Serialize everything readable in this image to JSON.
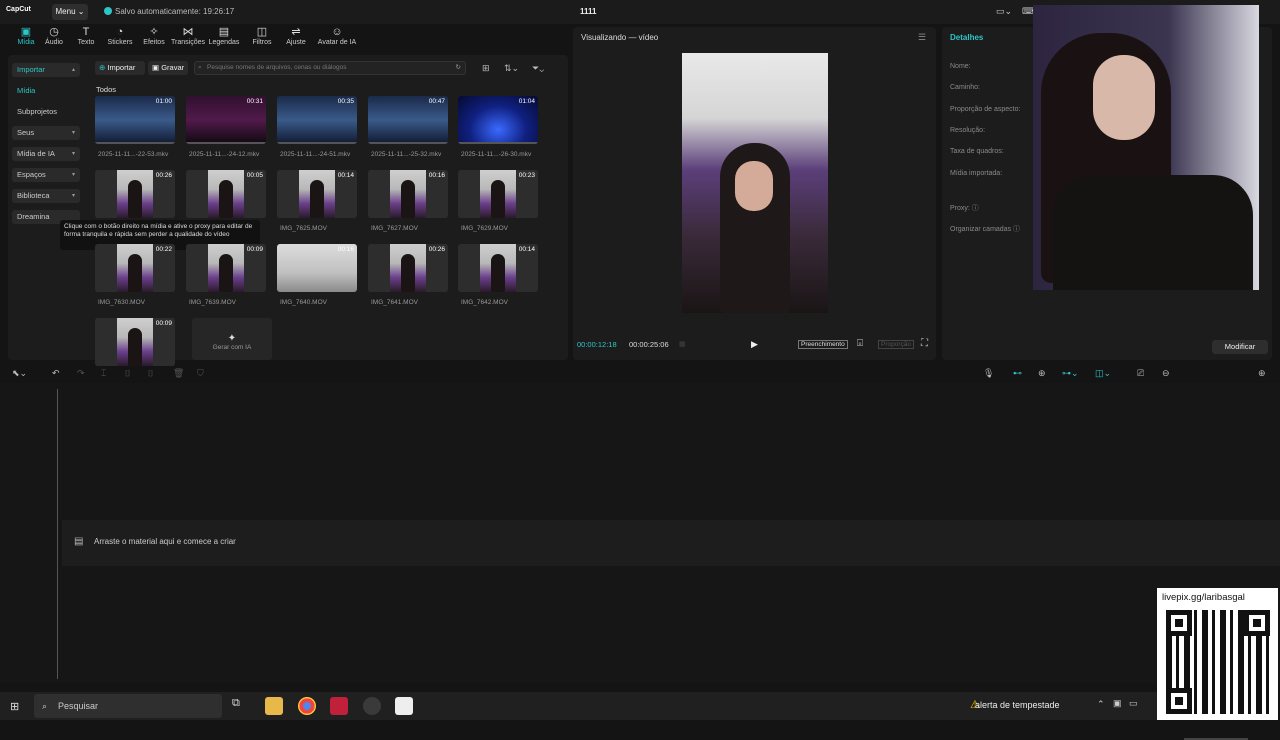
{
  "titlebar": {
    "logo": "CapCut",
    "menu_label": "Menu",
    "save_status": "Salvo automaticamente: 19:26:17",
    "project_title": "1111"
  },
  "toolbar": {
    "tools": [
      {
        "label": "Mídia",
        "icon": "media-icon"
      },
      {
        "label": "Áudio",
        "icon": "audio-icon"
      },
      {
        "label": "Texto",
        "icon": "text-icon"
      },
      {
        "label": "Stickers",
        "icon": "sticker-icon"
      },
      {
        "label": "Efeitos",
        "icon": "effects-icon"
      },
      {
        "label": "Transições",
        "icon": "transition-icon"
      },
      {
        "label": "Legendas",
        "icon": "captions-icon"
      },
      {
        "label": "Filtros",
        "icon": "filters-icon"
      },
      {
        "label": "Ajuste",
        "icon": "adjust-icon"
      },
      {
        "label": "Avatar de IA",
        "icon": "avatar-icon"
      }
    ]
  },
  "media": {
    "sidebar": {
      "import": "Importar",
      "media": "Mídia",
      "subprojects": "Subprojetos",
      "yours": "Seus",
      "ai_media": "Mídia de IA",
      "spaces": "Espaços",
      "library": "Biblioteca",
      "dreamina": "Dreamina"
    },
    "import_button": "Importar",
    "record_button": "Gravar",
    "search_placeholder": "Pesquise nomes de arquivos, cenas ou diálogos",
    "section_label": "Todos",
    "items": [
      {
        "name": "2025-11-11...-22-53.mkv",
        "duration": "01:00",
        "kind": "screen"
      },
      {
        "name": "2025-11-11...-24-12.mkv",
        "duration": "00:31",
        "kind": "dark"
      },
      {
        "name": "2025-11-11...-24-51.mkv",
        "duration": "00:35",
        "kind": "screen"
      },
      {
        "name": "2025-11-11...-25-32.mkv",
        "duration": "00:47",
        "kind": "screen"
      },
      {
        "name": "2025-11-11...-26-30.mkv",
        "duration": "01:04",
        "kind": "blue"
      },
      {
        "name": "",
        "duration": "00:26",
        "kind": "portrait"
      },
      {
        "name": "",
        "duration": "00:05",
        "kind": "portrait"
      },
      {
        "name": "IMG_7625.MOV",
        "duration": "00:14",
        "kind": "portrait"
      },
      {
        "name": "IMG_7627.MOV",
        "duration": "00:16",
        "kind": "portrait"
      },
      {
        "name": "IMG_7629.MOV",
        "duration": "00:23",
        "kind": "portrait"
      },
      {
        "name": "IMG_7630.MOV",
        "duration": "00:22",
        "kind": "portrait"
      },
      {
        "name": "IMG_7639.MOV",
        "duration": "00:09",
        "kind": "portrait"
      },
      {
        "name": "IMG_7640.MOV",
        "duration": "00:16",
        "kind": "white"
      },
      {
        "name": "IMG_7641.MOV",
        "duration": "00:26",
        "kind": "portrait"
      },
      {
        "name": "IMG_7642.MOV",
        "duration": "00:14",
        "kind": "portrait"
      },
      {
        "name": "",
        "duration": "00:09",
        "kind": "portrait"
      }
    ],
    "generate_ai": "Gerar com IA",
    "tooltip": "Clique com o botão direito na mídia e ative o proxy para editar de forma tranquila e rápida sem perder a qualidade do vídeo"
  },
  "preview": {
    "title": "Visualizando — vídeo",
    "current_time": "00:00:12:18",
    "total_time": "00:00:25:06",
    "fill_label": "Preenchimento",
    "ratio_label": "Proporção"
  },
  "details": {
    "title": "Detalhes",
    "labels": [
      "Nome:",
      "Caminho:",
      "Proporção de aspecto:",
      "Resolução:",
      "Taxa de quadros:",
      "Mídia importada:",
      "Proxy:",
      "Organizar camadas"
    ],
    "modify_button": "Modificar"
  },
  "timeline": {
    "drop_text": "Arraste o material aqui e comece a criar"
  },
  "overlay": {
    "livepix": "livepix.gg/laribasgal"
  },
  "taskbar": {
    "search": "Pesquisar",
    "weather": "alerta de tempestade"
  },
  "colors": {
    "accent": "#2ec5c5",
    "panel": "#1c1c1c",
    "background": "#141414"
  }
}
